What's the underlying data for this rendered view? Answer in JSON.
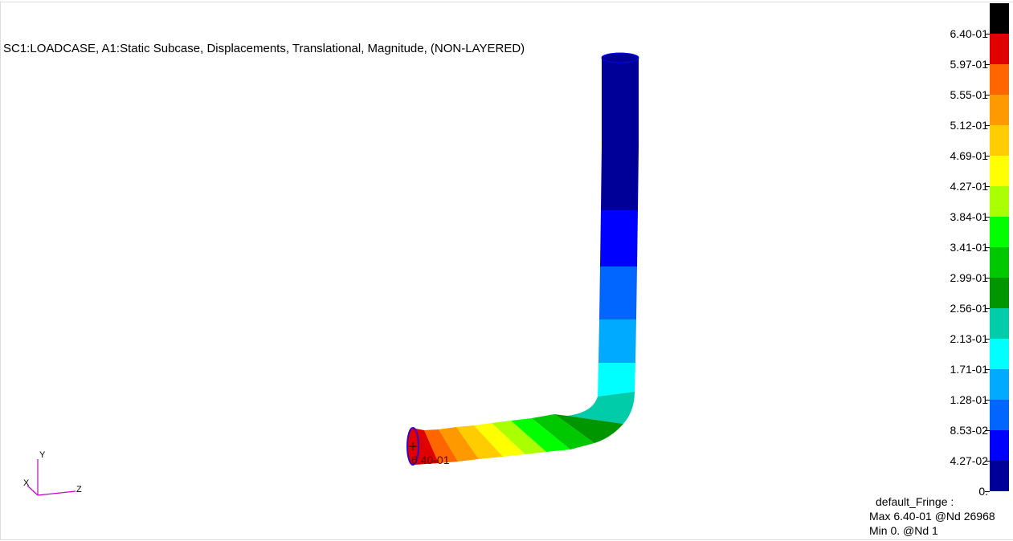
{
  "title": "SC1:LOADCASE, A1:Static Subcase, Displacements, Translational, Magnitude, (NON-LAYERED)",
  "legend": {
    "colors": [
      "#000000",
      "#e00000",
      "#ff6600",
      "#ff9900",
      "#ffcc00",
      "#ffff00",
      "#aaff00",
      "#00ff00",
      "#00c800",
      "#009600",
      "#00ccaa",
      "#00ffff",
      "#00aaff",
      "#0066ff",
      "#0000ff",
      "#000099"
    ],
    "labels": [
      "6.40-01",
      "5.97-01",
      "5.55-01",
      "5.12-01",
      "4.69-01",
      "4.27-01",
      "3.84-01",
      "3.41-01",
      "2.99-01",
      "2.56-01",
      "2.13-01",
      "1.71-01",
      "1.28-01",
      "8.53-02",
      "4.27-02",
      "0."
    ]
  },
  "fringe": {
    "name": "default_Fringe :",
    "max": "Max 6.40-01 @Nd 26968",
    "min": "Min  0. @Nd 1"
  },
  "model": {
    "end_label": "6.40-01"
  },
  "triad": {
    "x": "X",
    "y": "Y",
    "z": "Z",
    "color": "#cc00cc"
  }
}
